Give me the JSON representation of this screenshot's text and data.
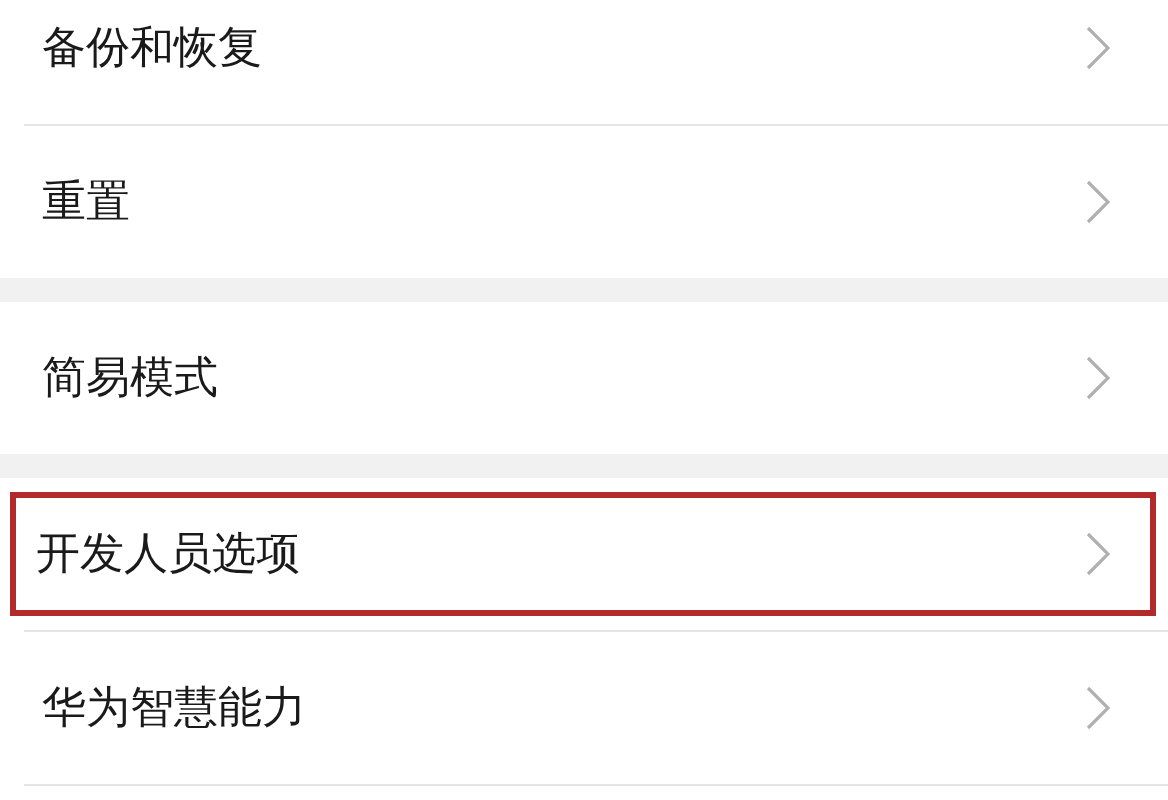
{
  "groups": [
    {
      "items": [
        {
          "label": "备份和恢复",
          "highlighted": false
        },
        {
          "label": "重置",
          "highlighted": false
        }
      ]
    },
    {
      "items": [
        {
          "label": "简易模式",
          "highlighted": false
        }
      ]
    },
    {
      "items": [
        {
          "label": "开发人员选项",
          "highlighted": true
        },
        {
          "label": "华为智慧能力",
          "highlighted": false
        }
      ]
    }
  ]
}
